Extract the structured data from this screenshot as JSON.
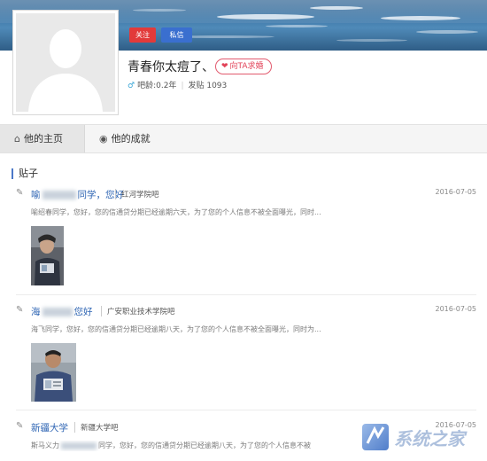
{
  "profile": {
    "follow_label": "关注",
    "message_label": "私信",
    "username": "青春你太痘了、",
    "propose_label": "向TA求婚",
    "age_label": "吧龄:0.2年",
    "posts_label": "发贴 1093"
  },
  "tabs": [
    {
      "label": "他的主页",
      "icon": "home-icon"
    },
    {
      "label": "他的成就",
      "icon": "medal-icon"
    }
  ],
  "section_title": "贴子",
  "posts": [
    {
      "title_prefix": "喻",
      "title_suffix": "同学，您好",
      "bar": "红河学院吧",
      "date": "2016-07-05",
      "snippet": "喻绍春同学，您好，您的信通贷分期已经逾期六天，为了您的个人信息不被全面曝光，同时..."
    },
    {
      "title_prefix": "海",
      "title_suffix": "您好",
      "bar": "广安职业技术学院吧",
      "date": "2016-07-05",
      "snippet": "海飞同学，您好，您的信通贷分期已经逾期八天，为了您的个人信息不被全面曝光，同时为..."
    },
    {
      "title_prefix": "新疆大学",
      "title_suffix": "",
      "bar": "新疆大学吧",
      "date": "2016-07-05",
      "snippet_prefix": "斯马义力",
      "snippet": "同学，您好，您的信通贷分期已经逾期八天，为了您的个人信息不被"
    }
  ],
  "watermark": "系统之家",
  "colors": {
    "accent_blue": "#2d64b3",
    "follow_red": "#e23a3a",
    "message_blue": "#3a6fcf",
    "propose_pink": "#e24359"
  }
}
